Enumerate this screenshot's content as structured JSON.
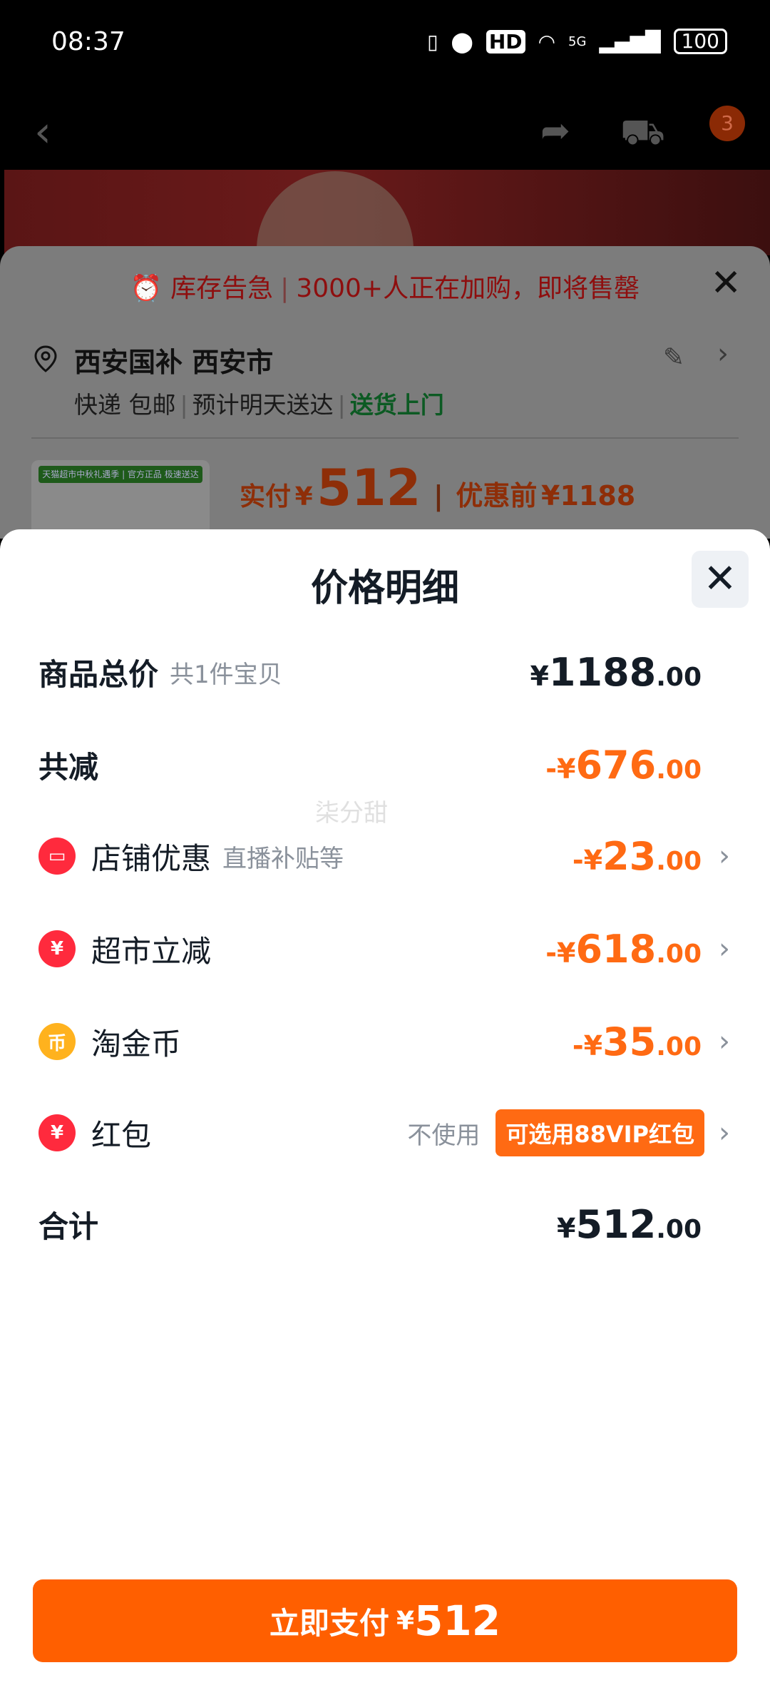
{
  "status": {
    "time": "08:37",
    "network": "5G",
    "hd": "HD",
    "battery": "100"
  },
  "nav": {
    "cart_badge": "3"
  },
  "under_sheet": {
    "alert_prefix": "库存告急",
    "alert_text": "3000+人正在加购，即将售罄",
    "address_title": "西安国补 西安市",
    "delivery_1": "快递 包邮",
    "delivery_2": "预计明天送达",
    "delivery_3": "送货上门",
    "thumb_tag": "天猫超市中秋礼遇季 | 官方正品 极速送达",
    "paid_label": "实付",
    "paid_yen": "¥",
    "paid_amount": "512",
    "pre_label": "优惠前",
    "pre_amount": "¥1188"
  },
  "sheet": {
    "title": "价格明细",
    "watermark": "柒分甜",
    "rows": {
      "total": {
        "label": "商品总价",
        "sub": "共1件宝贝",
        "yen": "¥",
        "int": "1188",
        "dec": ".00"
      },
      "discount": {
        "label": "共减",
        "yen": "-¥",
        "int": "676",
        "dec": ".00"
      },
      "shop": {
        "label": "店铺优惠",
        "sub": "直播补贴等",
        "yen": "-¥",
        "int": "23",
        "dec": ".00"
      },
      "market": {
        "label": "超市立减",
        "yen": "-¥",
        "int": "618",
        "dec": ".00"
      },
      "coin": {
        "label": "淘金币",
        "yen": "-¥",
        "int": "35",
        "dec": ".00"
      },
      "redpacket": {
        "label": "红包",
        "no_use": "不使用",
        "vip": "可选用88VIP红包"
      },
      "sum": {
        "label": "合计",
        "yen": "¥",
        "int": "512",
        "dec": ".00"
      }
    }
  },
  "pay_button": {
    "label": "立即支付",
    "yen": "¥",
    "amount": "512"
  }
}
